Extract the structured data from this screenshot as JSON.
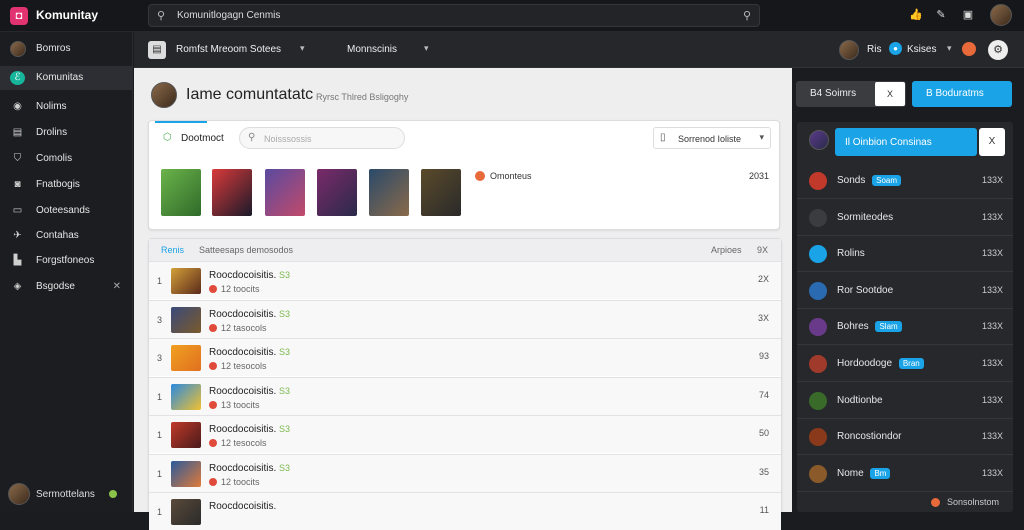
{
  "app": {
    "name": "Komunitay"
  },
  "search": {
    "value": "Komunitlogagn Cenmis"
  },
  "sidebar": {
    "items": [
      {
        "label": "Bomros",
        "icon": "user-avatar-icon"
      },
      {
        "label": "Komunitas",
        "icon": "community-icon"
      },
      {
        "label": "Nolims",
        "icon": "eye-icon"
      },
      {
        "label": "Drolins",
        "icon": "chat-icon"
      },
      {
        "label": "Comolis",
        "icon": "tag-icon"
      },
      {
        "label": "Fnatbogis",
        "icon": "camera-icon"
      },
      {
        "label": "Ooteesands",
        "icon": "message-icon"
      },
      {
        "label": "Contahas",
        "icon": "tool-icon"
      },
      {
        "label": "Forgstfoneos",
        "icon": "flag-icon"
      },
      {
        "label": "Bsgodse",
        "icon": "cart-icon"
      }
    ],
    "user": {
      "label": "Sermottelans"
    }
  },
  "subbar": {
    "tab1": "Romfst Mreoom Sotees",
    "tab2": "Monnscinis",
    "user_label": "Ris",
    "user_btn": "Ksises"
  },
  "header": {
    "title": "Iame comuntatatc",
    "subtitle": "Ryrsc Thlred Bsligoghy",
    "btn_dark": "B4 Soimrs",
    "btn_x": "X",
    "btn_blue": "B Boduratms"
  },
  "featured": {
    "title": "Dootmoct",
    "search_placeholder": "Noisssossis",
    "sort_label": "Sorrenod Ioliste",
    "extra_label": "Omonteus",
    "extra_value": "2031"
  },
  "list": {
    "header_tag": "Renis",
    "header_label": "Satteesaps demosodos",
    "header_right": "Arpioes",
    "header_right2": "9X",
    "rows": [
      {
        "num": "1",
        "title": "Roocdocoisitis.",
        "badge": "S3",
        "sub": "12 toocits",
        "value": "2X"
      },
      {
        "num": "3",
        "title": "Roocdocoisitis.",
        "badge": "S3",
        "sub": "12 tasocols",
        "value": "3X"
      },
      {
        "num": "3",
        "title": "Roocdocoisitis.",
        "badge": "S3",
        "sub": "12 tesocols",
        "value": "93"
      },
      {
        "num": "1",
        "title": "Roocdocoisitis.",
        "badge": "S3",
        "sub": "13 toocits",
        "value": "74"
      },
      {
        "num": "1",
        "title": "Roocdocoisitis.",
        "badge": "S3",
        "sub": "12 tesocols",
        "value": "50"
      },
      {
        "num": "1",
        "title": "Roocdocoisitis.",
        "badge": "S3",
        "sub": "12 toocits",
        "value": "35"
      },
      {
        "num": "1",
        "title": "Roocdocoisitis.",
        "badge": "",
        "sub": "",
        "value": "11"
      }
    ]
  },
  "right_panel": {
    "top_btn": "Il Oinbion Consinas",
    "close": "X",
    "items": [
      {
        "label": "Sonds",
        "pill": "Soam",
        "value": "133X"
      },
      {
        "label": "Sormiteodes",
        "pill": "",
        "value": "133X"
      },
      {
        "label": "Rolins",
        "pill": "",
        "value": "133X"
      },
      {
        "label": "Ror Sootdoe",
        "pill": "",
        "value": "133X"
      },
      {
        "label": "Bohres",
        "pill": "Slam",
        "value": "133X"
      },
      {
        "label": "Hordoodoge",
        "pill": "Bran",
        "value": "133X"
      },
      {
        "label": "Nodtionbe",
        "pill": "",
        "value": "133X"
      },
      {
        "label": "Roncostiondor",
        "pill": "",
        "value": "133X"
      },
      {
        "label": "Nome",
        "pill": "Bm",
        "value": "133X"
      }
    ],
    "footer": "Sonsolnstom"
  }
}
